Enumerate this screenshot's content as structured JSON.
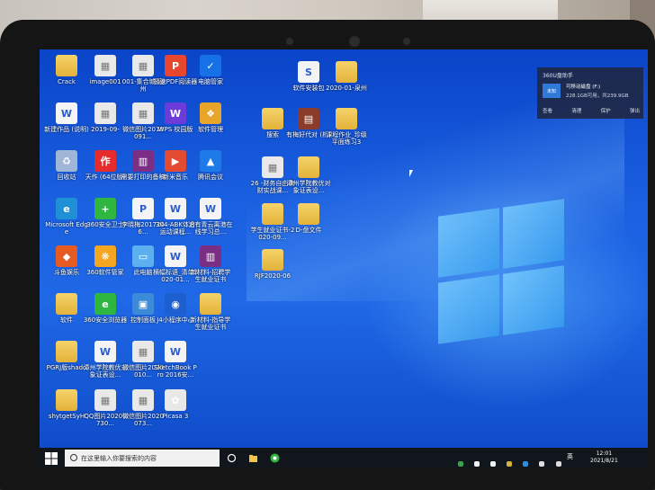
{
  "desktop": {
    "icons": [
      {
        "label": "Crack",
        "icon": "folder-icon"
      },
      {
        "label": "image001",
        "icon": "image-icon"
      },
      {
        "label": "001-集合城-泉州",
        "icon": "image-icon"
      },
      {
        "label": "极速PDF阅读器",
        "icon": "pdf-icon"
      },
      {
        "label": "电脑管家",
        "icon": "shield-icon"
      },
      {
        "label": "软件安装包",
        "icon": "spreadsheet-icon"
      },
      {
        "label": "2020-01-泉州",
        "icon": "folder-icon"
      },
      {
        "label": "新建作品 (说明)",
        "icon": "word-icon"
      },
      {
        "label": "2019-09-",
        "icon": "image-icon"
      },
      {
        "label": "微信图片2019091...",
        "icon": "image-icon"
      },
      {
        "label": "WPS 校园版",
        "icon": "wps-icon"
      },
      {
        "label": "软件管理",
        "icon": "app-manager-icon"
      },
      {
        "label": "搜索",
        "icon": "folder-icon"
      },
      {
        "label": "有梅好代对 (析)",
        "icon": "book-icon"
      },
      {
        "label": "课程作业_珍级平面练习3",
        "icon": "folder-icon"
      },
      {
        "label": "回收站",
        "icon": "recycle-bin-icon"
      },
      {
        "label": "天作 (64位版)",
        "icon": "app-icon"
      },
      {
        "label": "需要打印的备稿",
        "icon": "archive-icon"
      },
      {
        "label": "新米音乐",
        "icon": "music-icon"
      },
      {
        "label": "腾讯会议",
        "icon": "meeting-icon"
      },
      {
        "label": "26 -财务自由律财实战课...",
        "icon": "image-icon"
      },
      {
        "label": "漳州学院教优对象证表设...",
        "icon": "folder-icon"
      },
      {
        "label": "Microsoft Edge",
        "icon": "edge-icon"
      },
      {
        "label": "360安全卫士",
        "icon": "360-guard-icon"
      },
      {
        "label": "李晓梅2017246...",
        "icon": "ppt-icon"
      },
      {
        "label": "304-ABK体育运动课程...",
        "icon": "word-icon"
      },
      {
        "label": "沿有青云离港在线学习总...",
        "icon": "word-icon"
      },
      {
        "label": "学生就业证书-2020-09...",
        "icon": "folder-icon"
      },
      {
        "label": "D-盘文件",
        "icon": "folder-icon"
      },
      {
        "label": "斗鱼娱乐",
        "icon": "game-icon"
      },
      {
        "label": "360软件管家",
        "icon": "360-software-icon"
      },
      {
        "label": "此电脑",
        "icon": "computer-icon"
      },
      {
        "label": "横幅标语_清单2020-01...",
        "icon": "word-icon"
      },
      {
        "label": "新材料-招聘学生就业证书",
        "icon": "archive-icon"
      },
      {
        "label": "RJF2020-06",
        "icon": "folder-icon"
      },
      {
        "label": "软件",
        "icon": "folder-icon"
      },
      {
        "label": "360安全浏览器",
        "icon": "360-browser-icon"
      },
      {
        "label": "控制面板",
        "icon": "control-panel-icon"
      },
      {
        "label": "J4小程序中心",
        "icon": "mini-app-icon"
      },
      {
        "label": "新材料-指导学生就业证书",
        "icon": "folder-icon"
      },
      {
        "label": "PGRJ版shado",
        "icon": "folder-icon"
      },
      {
        "label": "漳州学院教优对象证表设...",
        "icon": "word-icon"
      },
      {
        "label": "微信图片2020010...",
        "icon": "image-icon"
      },
      {
        "label": "SketchBook Pro 2016安...",
        "icon": "word-icon"
      },
      {
        "label": "shytgetSyH",
        "icon": "folder-icon"
      },
      {
        "label": "QQ图片20200730...",
        "icon": "image-icon"
      },
      {
        "label": "微信图片2020073...",
        "icon": "image-icon"
      },
      {
        "label": "Picasa 3",
        "icon": "picasa-icon"
      }
    ]
  },
  "notification": {
    "title": "360U盘助手",
    "device": "可移动磁盘 (F:)",
    "space": "228.1GB可用，共239.9GB",
    "drive_label": "未知",
    "actions": [
      "查看",
      "清理",
      "保护",
      "弹出"
    ]
  },
  "taskbar": {
    "search_placeholder": "在这里输入你要搜索的内容",
    "ime": "英",
    "time": "12:01",
    "date": "2021/8/21"
  },
  "colors": {
    "desktop": "#1a5fe0",
    "taskbar": "#11151c",
    "notification_bg": "#1e2846"
  }
}
